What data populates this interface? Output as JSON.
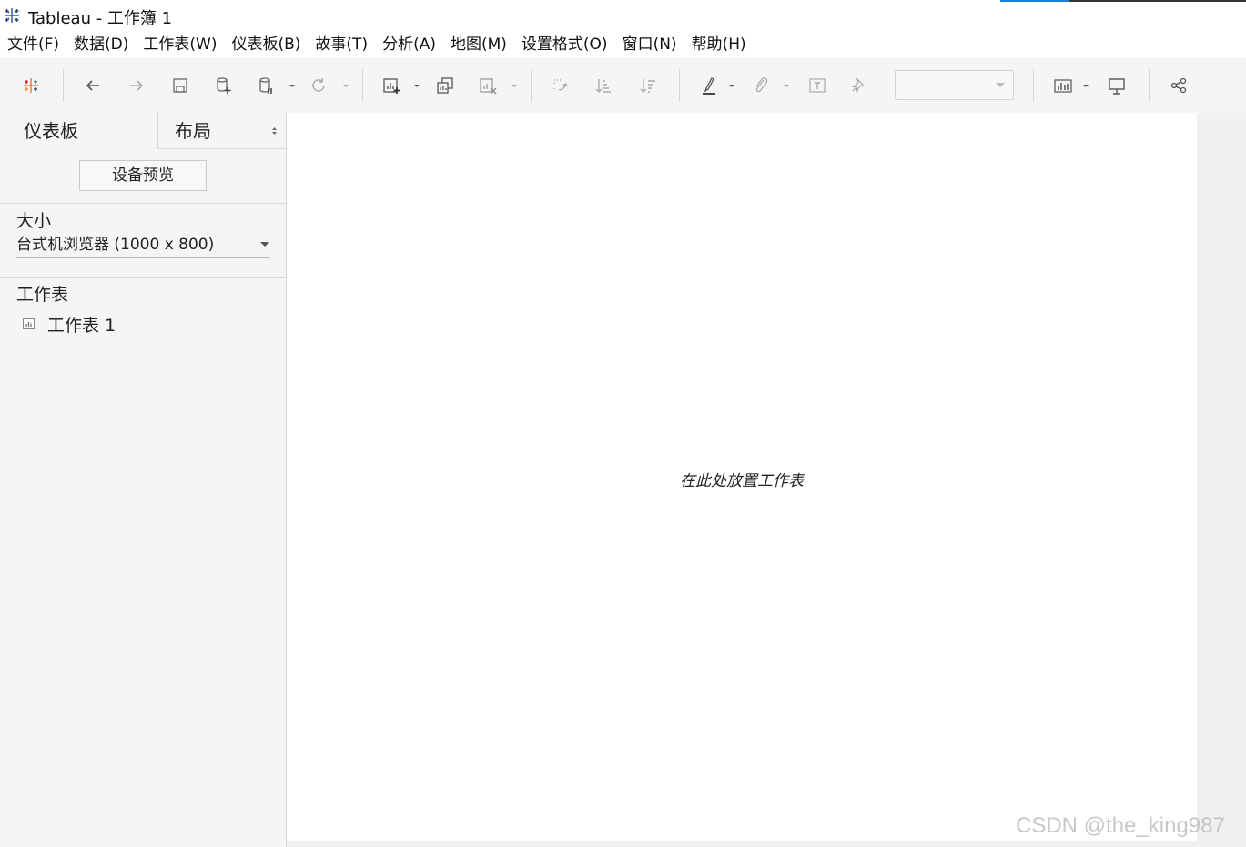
{
  "window": {
    "title": "Tableau - 工作簿 1",
    "app_icon": "tableau-logo-icon",
    "loading_progress": 0.28
  },
  "menubar": {
    "items": [
      "文件(F)",
      "数据(D)",
      "工作表(W)",
      "仪表板(B)",
      "故事(T)",
      "分析(A)",
      "地图(M)",
      "设置格式(O)",
      "窗口(N)",
      "帮助(H)"
    ]
  },
  "toolbar": {
    "icons": [
      "tableau-logo-icon",
      "back-arrow-icon",
      "forward-arrow-icon",
      "save-icon",
      "new-data-source-icon",
      "pause-auto-updates-icon",
      "refresh-icon",
      "new-worksheet-icon",
      "duplicate-sheet-icon",
      "clear-sheet-icon",
      "swap-rows-columns-icon",
      "sort-ascending-icon",
      "sort-descending-icon",
      "highlight-icon",
      "group-members-icon",
      "show-mark-labels-icon",
      "fix-axes-icon",
      "show-me-icon",
      "presentation-mode-icon",
      "share-icon"
    ],
    "fit_select_value": ""
  },
  "left_panel": {
    "tabs": [
      "仪表板",
      "布局"
    ],
    "device_preview_label": "设备预览",
    "size_section": {
      "title": "大小",
      "selected": "台式机浏览器 (1000 x 800)"
    },
    "sheets_section": {
      "title": "工作表",
      "items": [
        "工作表 1"
      ]
    }
  },
  "canvas": {
    "drop_hint": "在此处放置工作表"
  },
  "watermark": "CSDN @the_king987",
  "colors": {
    "accent": "#1e7fd8",
    "logo_blue": "#1f457e",
    "logo_orange": "#e8762c",
    "logo_red": "#c72035"
  }
}
